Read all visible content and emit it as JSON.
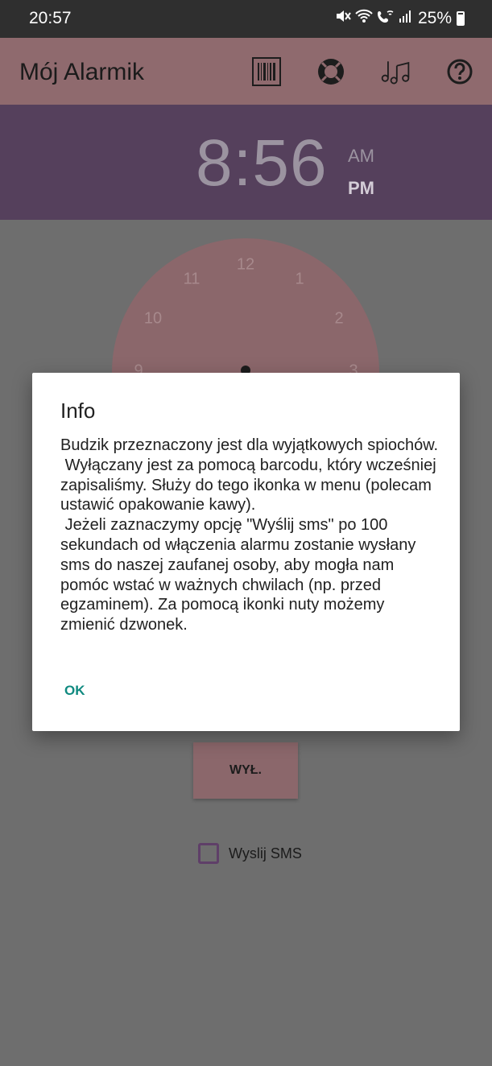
{
  "status_bar": {
    "time": "20:57",
    "battery": "25%",
    "icons": [
      "mute-icon",
      "wifi-icon",
      "wifi-call-icon",
      "signal-icon",
      "battery-icon"
    ]
  },
  "app_bar": {
    "title": "Mój Alarmik",
    "actions": [
      "barcode-icon",
      "lifebuoy-icon",
      "music-note-icon",
      "help-icon"
    ]
  },
  "alarm_time": {
    "digits": "8:56",
    "am": "AM",
    "pm": "PM",
    "selected": "PM"
  },
  "clock": {
    "numbers": [
      "12",
      "1",
      "2",
      "3",
      "9",
      "10",
      "11"
    ]
  },
  "dialog": {
    "title": "Info",
    "message": "Budzik przeznaczony jest dla wyjątkowych spiochów.\n Wyłączany jest za pomocą barcodu, który wcześniej zapisaliśmy. Służy do tego ikonka w menu (polecam ustawić opakowanie kawy).\n Jeżeli zaznaczymy opcję \"Wyślij sms\" po 100 sekundach od włączenia alarmu zostanie wysłany sms do naszej zaufanej osoby, aby mogła nam pomóc wstać w ważnych chwilach (np. przed egzaminem). Za pomocą ikonki nuty możemy zmienić dzwonek.",
    "ok": "OK"
  },
  "off_button": {
    "label": "WYŁ."
  },
  "sms_option": {
    "label": "Wyslij SMS",
    "checked": false
  },
  "colors": {
    "app_bar": "#8f6a6e",
    "time_header": "#55405c",
    "accent": "#108a80",
    "scrim": "#6e6e6e"
  }
}
